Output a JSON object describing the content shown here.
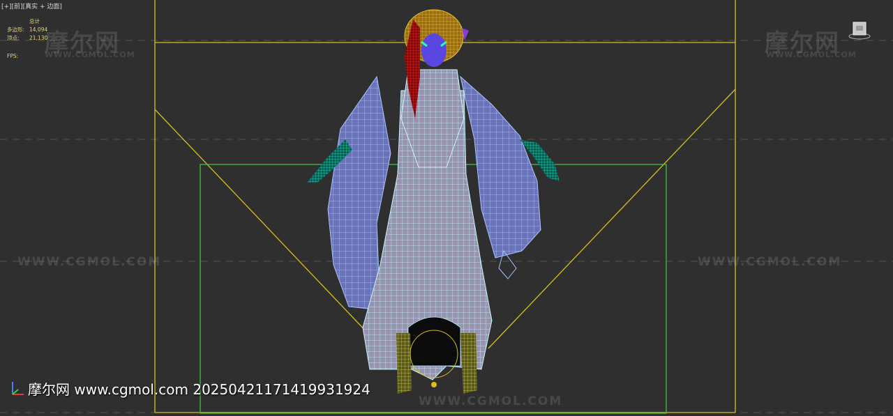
{
  "viewport": {
    "label_parts": [
      "[+]",
      "[前]",
      "[真实 + 边面]"
    ],
    "stats": {
      "header": "总计",
      "polygons_label": "多边形:",
      "polygons_value": "14,094",
      "vertices_label": "顶点:",
      "vertices_value": "21,130"
    },
    "fps_label": "FPS:"
  },
  "watermarks": {
    "logo_text": "摩尔网",
    "url_text": "WWW.CGMOL.COM",
    "footer_text": "摩尔网 www.cgmol.com 20250421171419931924"
  },
  "viewcube": {
    "icon": "viewcube-icon"
  },
  "axis_gizmo": {
    "icon": "axis-gizmo-icon"
  },
  "colors": {
    "viewport_bg": "#2f2f2f",
    "frame_yellow": "#d8c11a",
    "frame_green": "#3fbf3f",
    "wire_blue": "#8fb0ff",
    "wire_cyan": "#a9f2ff",
    "hair_yellow": "#d6a11a",
    "hair_red": "#c81a1a",
    "hand_teal": "#1fb39a",
    "stats_text": "#e8d27a"
  }
}
